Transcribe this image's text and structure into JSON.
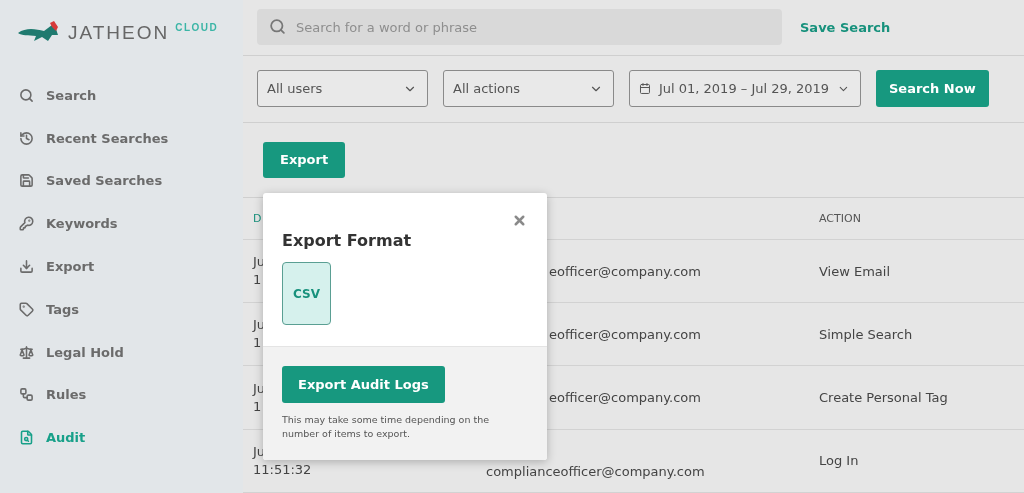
{
  "logo": {
    "brand": "JATHEON",
    "product": "CLOUD"
  },
  "sidebar": {
    "items": [
      {
        "label": "Search",
        "selected": false
      },
      {
        "label": "Recent Searches",
        "selected": false
      },
      {
        "label": "Saved Searches",
        "selected": false
      },
      {
        "label": "Keywords",
        "selected": false
      },
      {
        "label": "Export",
        "selected": false
      },
      {
        "label": "Tags",
        "selected": false
      },
      {
        "label": "Legal Hold",
        "selected": false
      },
      {
        "label": "Rules",
        "selected": false
      },
      {
        "label": "Audit",
        "selected": true
      }
    ]
  },
  "search": {
    "placeholder": "Search for a word or phrase",
    "save_label": "Save Search"
  },
  "filters": {
    "users": "All users",
    "actions": "All actions",
    "date_range": "Jul 01, 2019 – Jul 29, 2019",
    "search_button": "Search Now"
  },
  "export_button": "Export",
  "table": {
    "columns": [
      "D",
      "ACTION"
    ],
    "rows": [
      {
        "date": [
          "Ju",
          "1"
        ],
        "user": "eofficer@company.com",
        "action": "View Email"
      },
      {
        "date": [
          "Ju",
          "1"
        ],
        "user": "eofficer@company.com",
        "action": "Simple Search"
      },
      {
        "date": [
          "Ju",
          "1"
        ],
        "user": "eofficer@company.com",
        "action": "Create Personal Tag"
      },
      {
        "date": [
          "Ju",
          "11:51:32"
        ],
        "user": "complianceofficer@company.com",
        "action": "Log In"
      }
    ]
  },
  "modal": {
    "title": "Export Format",
    "formats": [
      {
        "label": "CSV",
        "selected": true
      }
    ],
    "button": "Export Audit Logs",
    "note": "This may take some time depending on the number of items to export."
  }
}
